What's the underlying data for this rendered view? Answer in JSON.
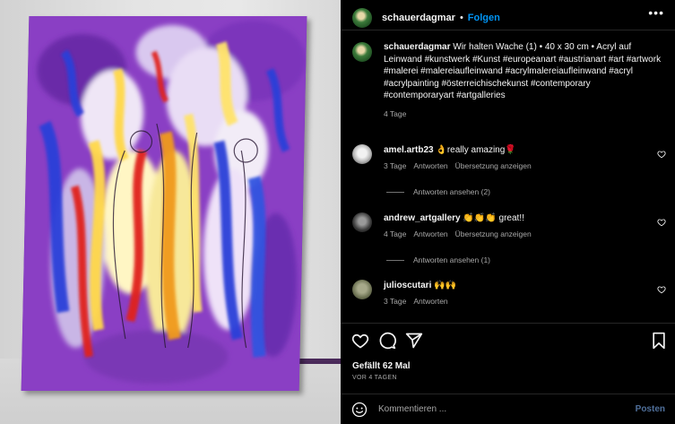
{
  "post": {
    "username": "schauerdagmar",
    "follow_label": "Folgen",
    "more_label": "•••"
  },
  "caption": {
    "username": "schauerdagmar",
    "text": "Wir halten Wache (1) • 40 x 30 cm • Acryl auf Leinwand #kunstwerk #Kunst #europeanart #austrianart #art #artwork #malerei #malereiaufleinwand #acrylmalereiaufleinwand #acryl #acrylpainting #österreichischekunst #contemporary #contemporaryart #artgalleries",
    "time": "4 Tage"
  },
  "comments": [
    {
      "username": "amel.artb23",
      "text": "👌really amazing🌹",
      "time": "3 Tage",
      "reply_label": "Antworten",
      "translate_label": "Übersetzung anzeigen",
      "view_replies": "Antworten ansehen (2)"
    },
    {
      "username": "andrew_artgallery",
      "text": "👏👏👏 great!!",
      "time": "4 Tage",
      "reply_label": "Antworten",
      "translate_label": "Übersetzung anzeigen",
      "view_replies": "Antworten ansehen (1)"
    },
    {
      "username": "julioscutari",
      "text": "🙌🙌",
      "time": "3 Tage",
      "reply_label": "Antworten"
    }
  ],
  "stats": {
    "likes": "Gefällt 62 Mal",
    "ago": "VOR 4 TAGEN"
  },
  "composer": {
    "placeholder": "Kommentieren ...",
    "post_label": "Posten"
  },
  "colors": {
    "accent": "#0095f6",
    "background": "#000000",
    "muted_text": "#a8a8a8"
  }
}
